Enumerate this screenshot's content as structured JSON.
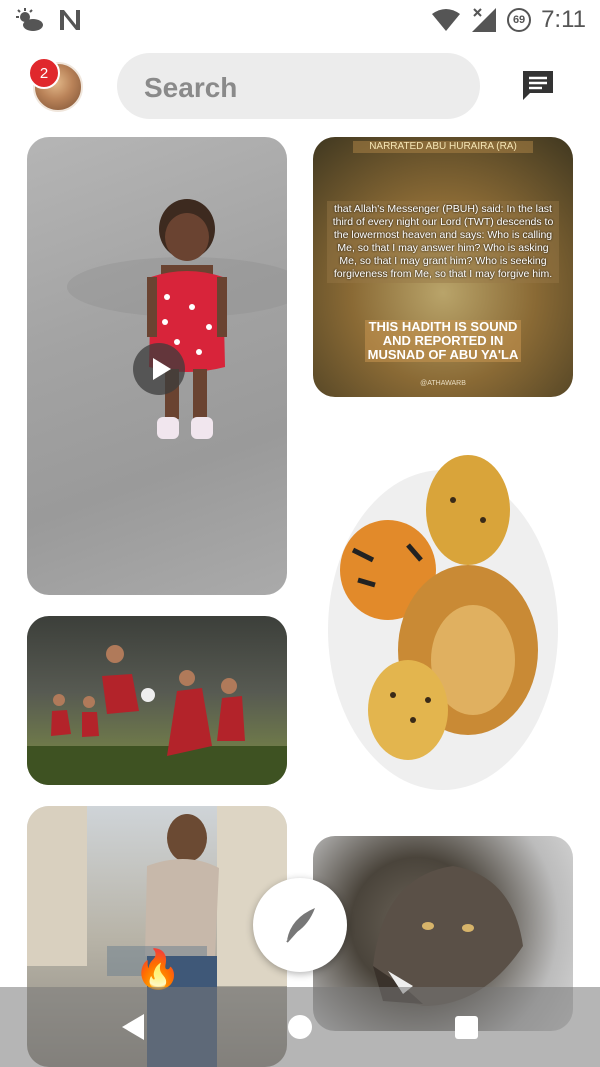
{
  "status_bar": {
    "time": "7:11",
    "battery_level": "69",
    "icons": [
      "weather-icon",
      "n-notification-icon",
      "wifi-icon",
      "no-signal-icon",
      "battery-icon"
    ]
  },
  "header": {
    "notification_count": "2",
    "search_placeholder": "Search"
  },
  "feed": {
    "pins": [
      {
        "subject": "child-video",
        "has_play": true
      },
      {
        "subject": "kaaba-quote",
        "heading": "NARRATED ABU HURAIRA (RA)",
        "body": "that Allah's Messenger (PBUH) said: In the last third of every night our Lord (TWT) descends to the lowermost heaven and says: Who is calling Me, so that I may answer him? Who is asking Me, so that I may grant him? Who is seeking forgiveness from Me, so that I may forgive him.",
        "footer": "THIS HADITH IS SOUND AND REPORTED IN MUSNAD OF ABU YA'LA",
        "credit": "@ATHAWARB"
      },
      {
        "subject": "monks-football"
      },
      {
        "subject": "big-cats-art"
      },
      {
        "subject": "man-city-street"
      },
      {
        "subject": "wolf"
      }
    ]
  },
  "overlay": {
    "fire_emoji": "🔥"
  },
  "colors": {
    "badge": "#e0282c",
    "search_bg": "#ececec",
    "status_icons": "#555555"
  }
}
